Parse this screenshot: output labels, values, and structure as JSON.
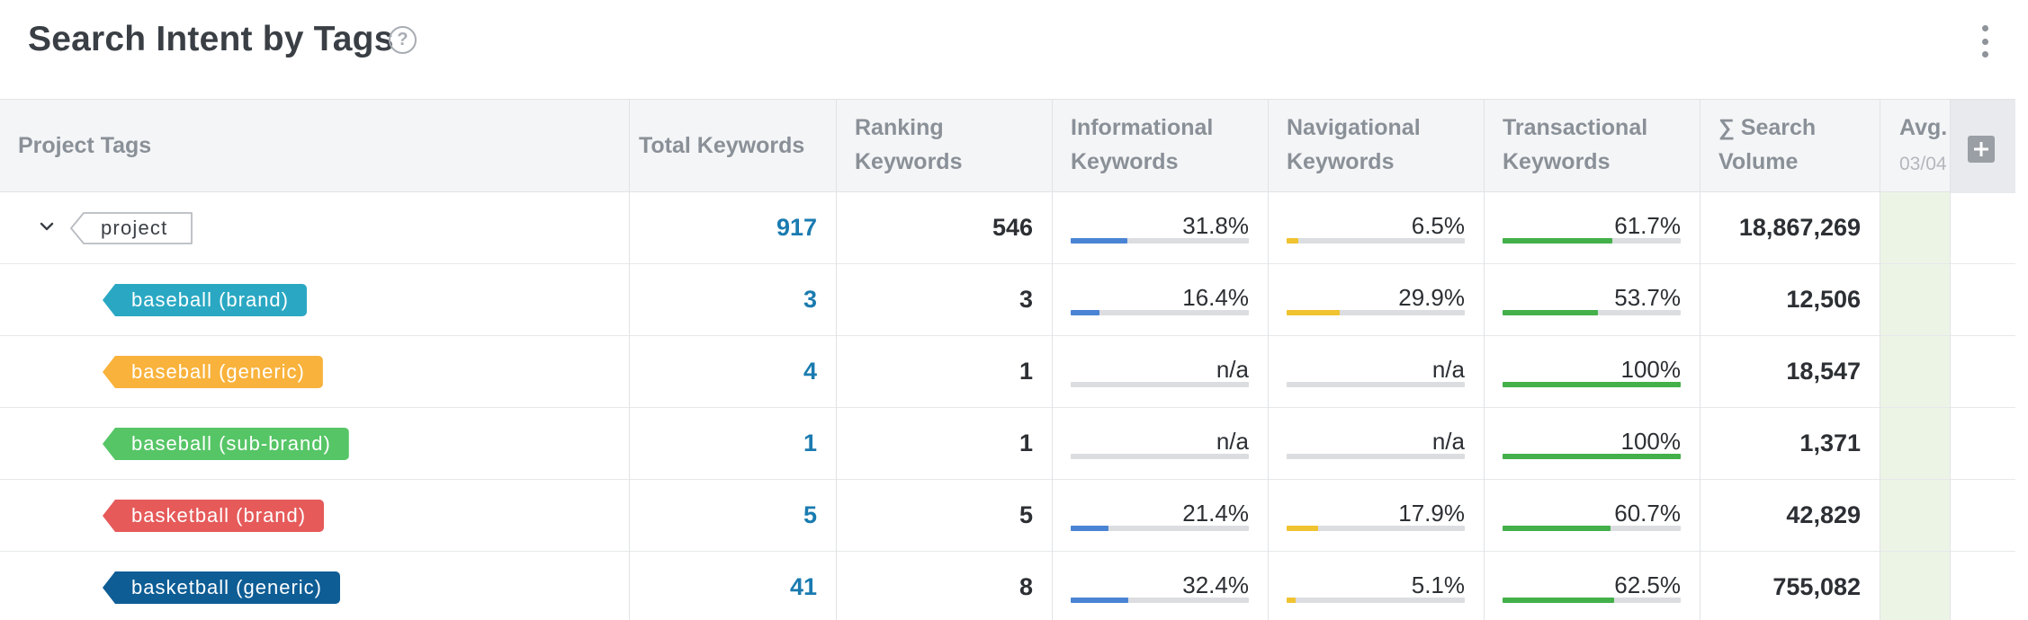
{
  "widget": {
    "title": "Search Intent by Tags",
    "help_icon": "question-circle-icon",
    "menu_icon": "kebab-vertical-icon"
  },
  "columns": {
    "project_tags": "Project Tags",
    "total_keywords": "Total Keywords",
    "ranking_keywords": [
      "Ranking",
      "Keywords"
    ],
    "informational": [
      "Informational",
      "Keywords"
    ],
    "navigational": [
      "Navigational",
      "Keywords"
    ],
    "transactional": [
      "Transactional",
      "Keywords"
    ],
    "search_volume": [
      "∑ Search",
      "Volume"
    ],
    "avg": "Avg.",
    "avg_sub": "03/04",
    "add_column_icon": "plus-icon"
  },
  "colors": {
    "informational": "#4a84d4",
    "navigational": "#f0c330",
    "transactional": "#43b04a",
    "link": "#1a7bb0"
  },
  "rows": [
    {
      "tag": "project",
      "tag_style": "outline",
      "expand_icon": "chevron-down-icon",
      "total": "917",
      "ranking": "546",
      "info": "31.8%",
      "info_frac": 0.318,
      "nav": "6.5%",
      "nav_frac": 0.065,
      "trans": "61.7%",
      "trans_frac": 0.617,
      "volume": "18,867,269"
    },
    {
      "tag": "baseball (brand)",
      "tag_color": "#2aa8c3",
      "total": "3",
      "ranking": "3",
      "info": "16.4%",
      "info_frac": 0.164,
      "nav": "29.9%",
      "nav_frac": 0.299,
      "trans": "53.7%",
      "trans_frac": 0.537,
      "volume": "12,506"
    },
    {
      "tag": "baseball (generic)",
      "tag_color": "#f9b23b",
      "total": "4",
      "ranking": "1",
      "info": "n/a",
      "info_frac": 0,
      "nav": "n/a",
      "nav_frac": 0,
      "trans": "100%",
      "trans_frac": 1.0,
      "volume": "18,547"
    },
    {
      "tag": "baseball (sub-brand)",
      "tag_color": "#56c566",
      "total": "1",
      "ranking": "1",
      "info": "n/a",
      "info_frac": 0,
      "nav": "n/a",
      "nav_frac": 0,
      "trans": "100%",
      "trans_frac": 1.0,
      "volume": "1,371"
    },
    {
      "tag": "basketball (brand)",
      "tag_color": "#e65a5a",
      "total": "5",
      "ranking": "5",
      "info": "21.4%",
      "info_frac": 0.214,
      "nav": "17.9%",
      "nav_frac": 0.179,
      "trans": "60.7%",
      "trans_frac": 0.607,
      "volume": "42,829"
    },
    {
      "tag": "basketball (generic)",
      "tag_color": "#0e5d95",
      "total": "41",
      "ranking": "8",
      "info": "32.4%",
      "info_frac": 0.324,
      "nav": "5.1%",
      "nav_frac": 0.051,
      "trans": "62.5%",
      "trans_frac": 0.625,
      "volume": "755,082"
    }
  ]
}
